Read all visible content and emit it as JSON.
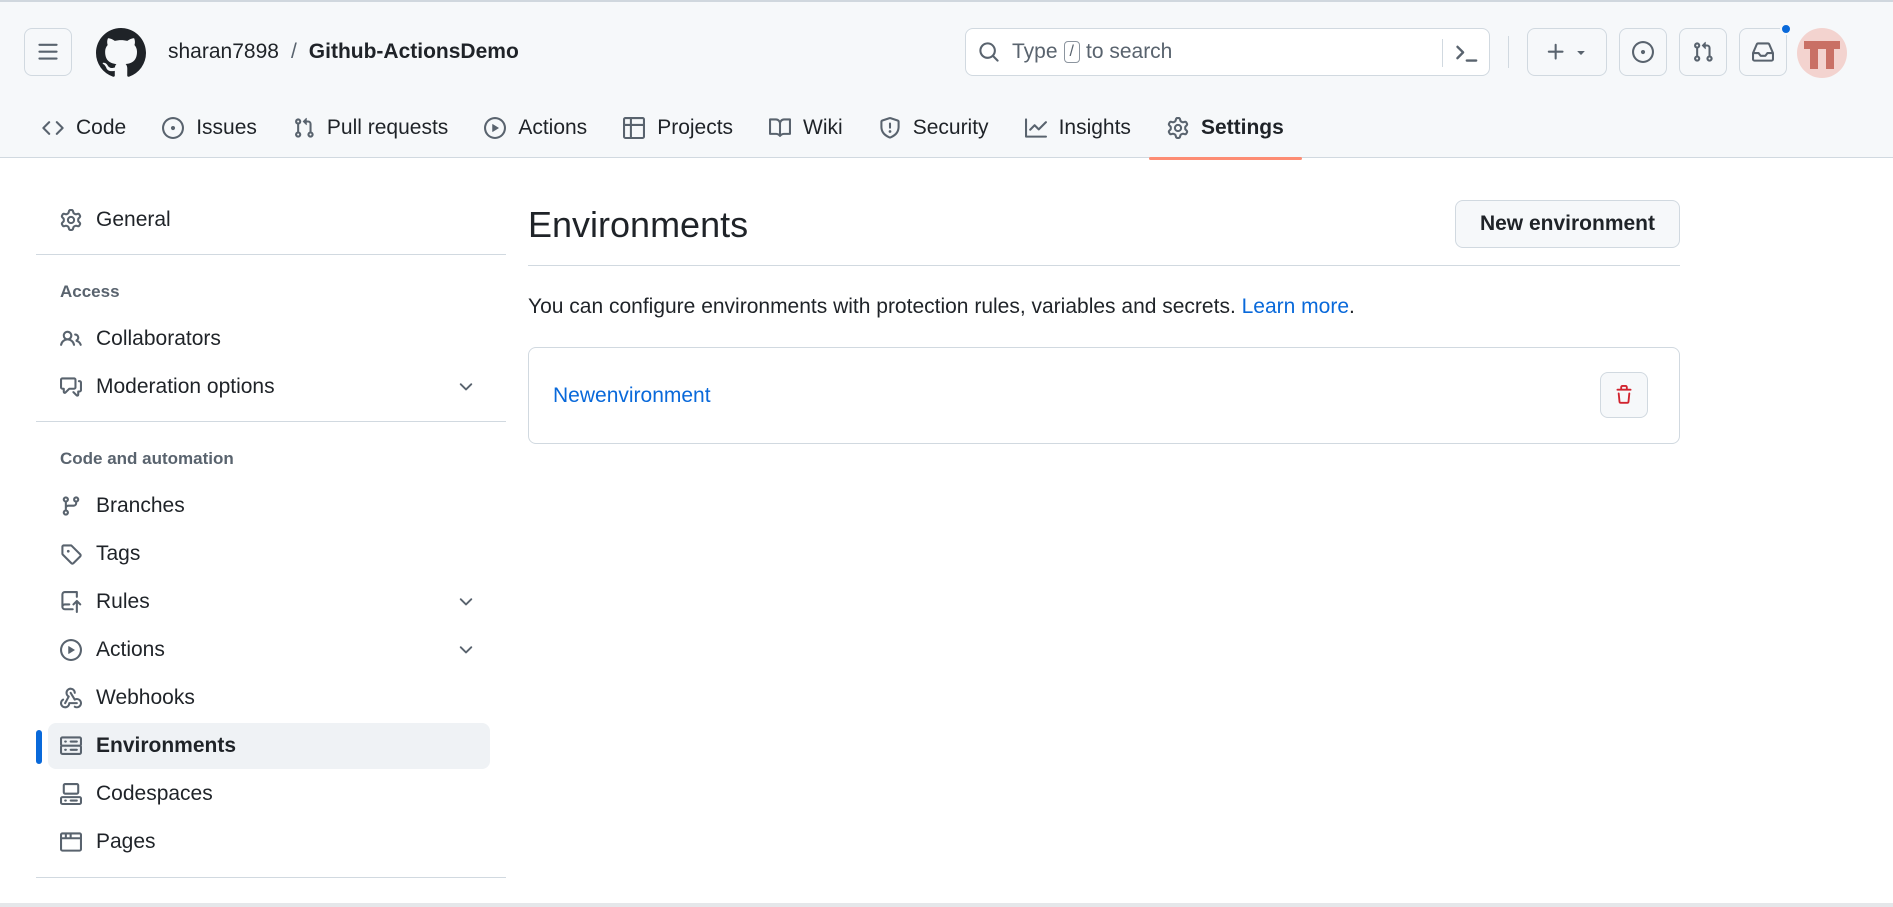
{
  "header": {
    "owner": "sharan7898",
    "separator": "/",
    "repo": "Github-ActionsDemo",
    "search": {
      "before": "Type",
      "key": "/",
      "after": "to search"
    }
  },
  "repo_nav": [
    {
      "label": "Code",
      "icon": "code-icon"
    },
    {
      "label": "Issues",
      "icon": "issue-opened-icon"
    },
    {
      "label": "Pull requests",
      "icon": "git-pull-request-icon"
    },
    {
      "label": "Actions",
      "icon": "play-icon"
    },
    {
      "label": "Projects",
      "icon": "table-icon"
    },
    {
      "label": "Wiki",
      "icon": "book-icon"
    },
    {
      "label": "Security",
      "icon": "shield-icon"
    },
    {
      "label": "Insights",
      "icon": "graph-icon"
    },
    {
      "label": "Settings",
      "icon": "gear-icon",
      "active": true
    }
  ],
  "sidebar": {
    "general": "General",
    "access_heading": "Access",
    "collaborators": "Collaborators",
    "moderation": "Moderation options",
    "code_heading": "Code and automation",
    "branches": "Branches",
    "tags": "Tags",
    "rules": "Rules",
    "actions": "Actions",
    "webhooks": "Webhooks",
    "environments": "Environments",
    "codespaces": "Codespaces",
    "pages": "Pages"
  },
  "main": {
    "title": "Environments",
    "new_button": "New environment",
    "description": "You can configure environments with protection rules, variables and secrets.",
    "learn_more": "Learn more",
    "period": ".",
    "environments": [
      {
        "name": "Newenvironment"
      }
    ]
  },
  "colors": {
    "accent": "#0969da",
    "active_tab_underline": "#fd8c73",
    "danger": "#d1242f",
    "notification_dot": "#0969da"
  }
}
